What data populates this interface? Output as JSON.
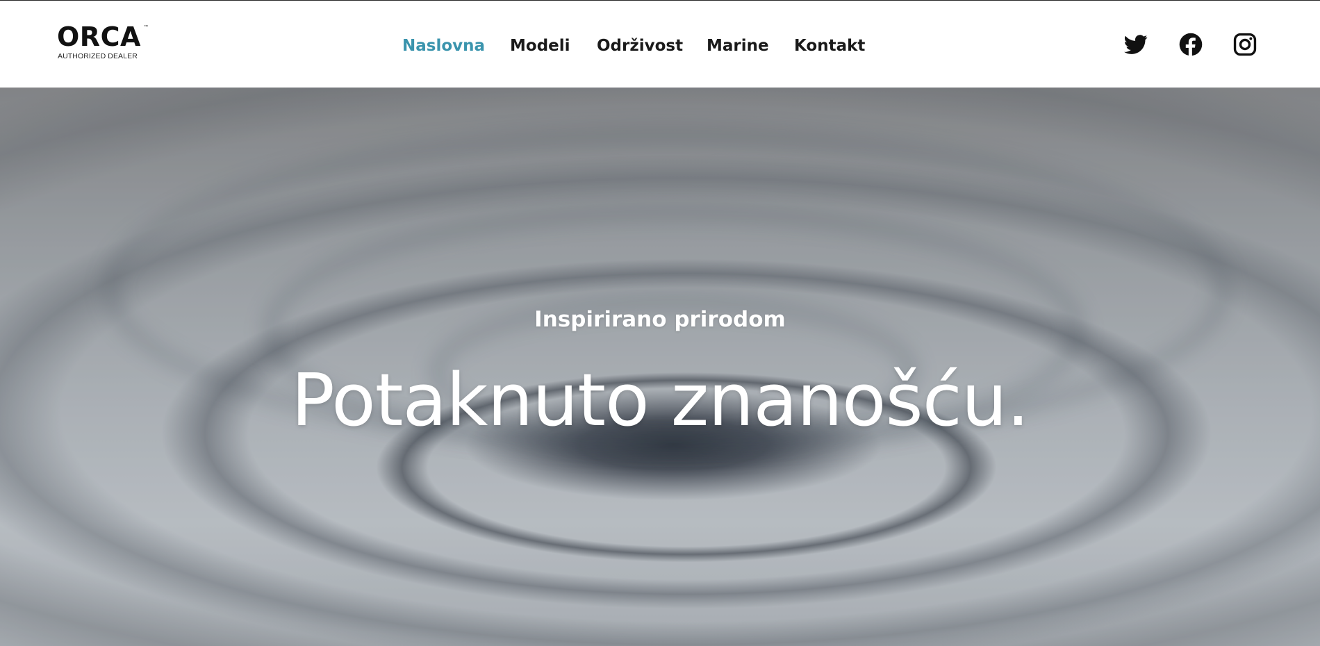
{
  "brand": {
    "name": "ORCA",
    "tagline": "AUTHORIZED DEALER",
    "trademark": "™"
  },
  "nav": {
    "items": [
      {
        "label": "Naslovna",
        "active": true
      },
      {
        "label": "Modeli",
        "active": false
      },
      {
        "label": "Održivost",
        "active": false
      },
      {
        "label": "Marine",
        "active": false
      },
      {
        "label": "Kontakt",
        "active": false
      }
    ],
    "active_color": "#3a94ad",
    "text_color": "#1a1a1a"
  },
  "social": {
    "icons": [
      "twitter-icon",
      "facebook-icon",
      "instagram-icon"
    ]
  },
  "hero": {
    "eyebrow": "Inspirirano prirodom",
    "headline": "Potaknuto znanošću."
  }
}
